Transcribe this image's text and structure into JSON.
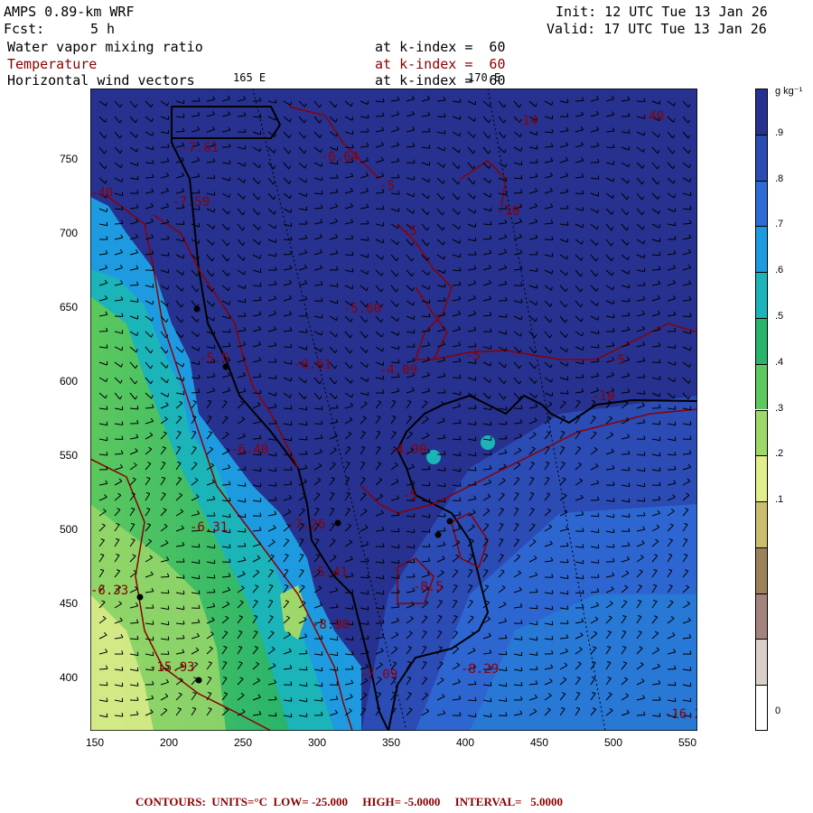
{
  "header": {
    "model": "AMPS 0.89-km WRF",
    "fcst_label": "Fcst:",
    "fcst_value": "5 h",
    "init": "Init: 12 UTC Tue 13 Jan 26",
    "valid": "Valid: 17 UTC Tue 13 Jan 26"
  },
  "fields": [
    {
      "name": "Water vapor mixing ratio",
      "level": "at k-index =  60",
      "color": "#000000"
    },
    {
      "name": "Temperature",
      "level": "at k-index =  60",
      "color": "#8b0000"
    },
    {
      "name": "Horizontal wind vectors",
      "level": "at k-index =  60",
      "color": "#000000"
    }
  ],
  "lon_labels": [
    "165 E",
    "170 E"
  ],
  "x_ticks": [
    "150",
    "200",
    "250",
    "300",
    "350",
    "400",
    "450",
    "500",
    "550"
  ],
  "y_ticks": [
    "400",
    "450",
    "500",
    "550",
    "600",
    "650",
    "700",
    "750"
  ],
  "colorbar": {
    "unit": "g kg⁻¹",
    "labels": [
      ".9",
      ".8",
      ".7",
      ".6",
      ".5",
      ".4",
      ".3",
      ".2",
      ".1",
      "0"
    ],
    "colors": [
      "#27318f",
      "#2b4bb5",
      "#2f6bd6",
      "#1e9be0",
      "#1bb4b8",
      "#28b46a",
      "#5cc85e",
      "#9ed86a",
      "#e2ee8c",
      "#c9be6e",
      "#9c8159",
      "#a4837e",
      "#d9cfcb",
      "#ffffff"
    ]
  },
  "contour_labels": [
    "-7.61",
    "-6.64",
    "-14",
    "-40",
    "-40",
    "-7.59",
    "-5",
    "-10",
    "-5",
    "-5.60",
    "-8.61",
    "-4.09",
    "-5",
    "-5",
    "-10",
    "-5.5",
    "-6.40",
    "-4.90",
    "-6.31",
    "-7.26",
    "-5",
    "-5.41",
    "-8.5",
    "-8.90",
    "-6.33",
    "-15.93",
    "-7.09",
    "-8.29",
    "-16.2"
  ],
  "footer": "CONTOURS:  UNITS=°C  LOW= -25.000     HIGH= -5.0000     INTERVAL=   5.0000"
}
